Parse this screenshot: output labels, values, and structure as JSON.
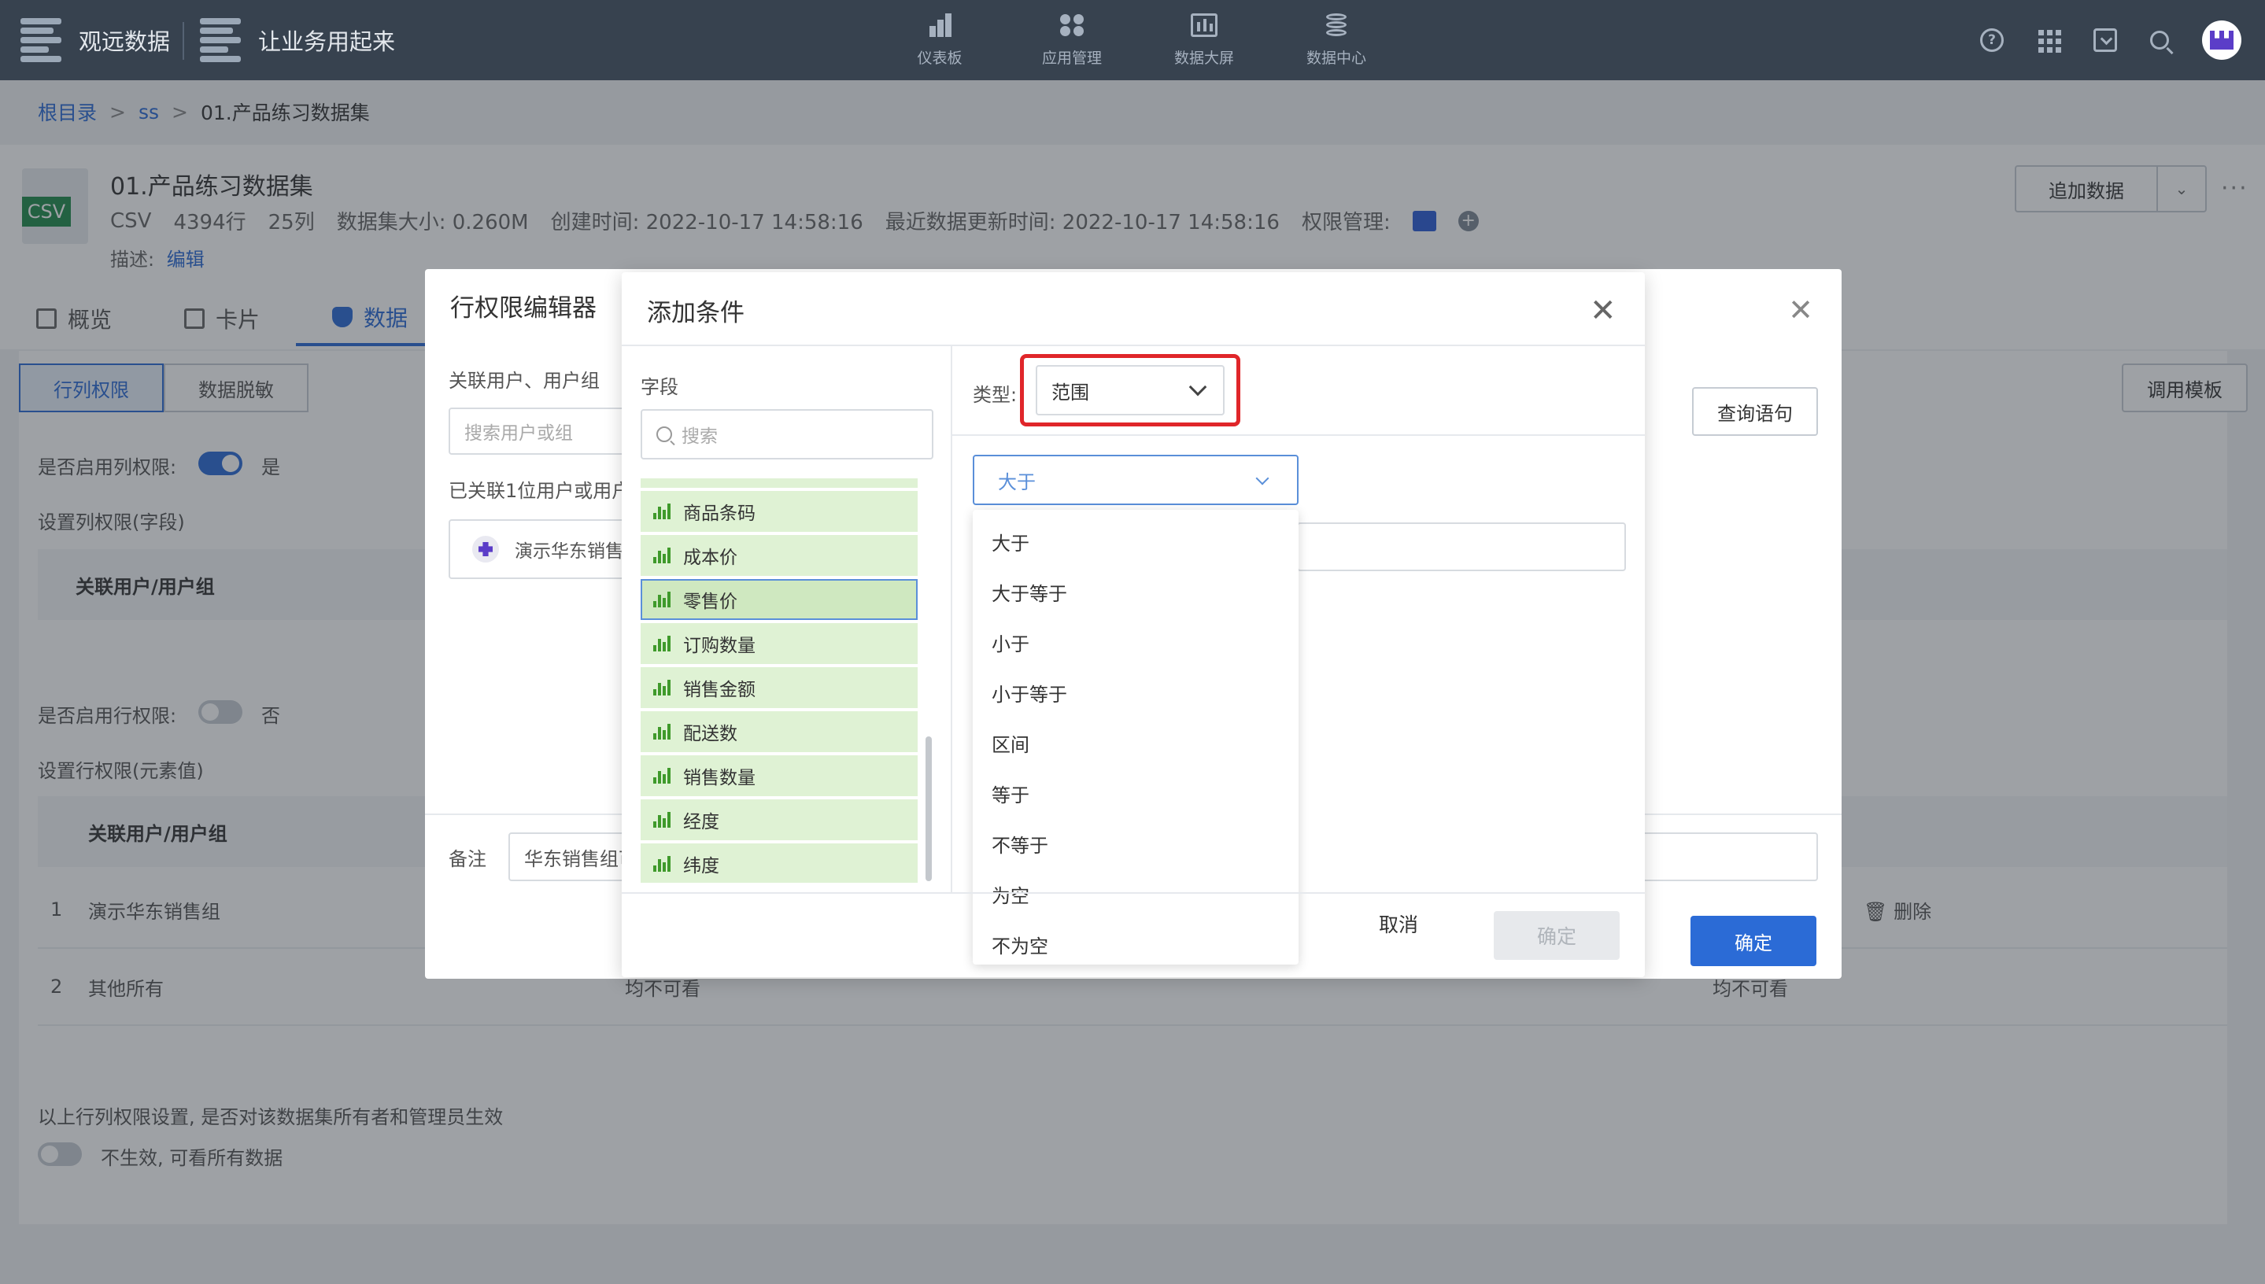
{
  "topbar": {
    "brand1": "观远数据",
    "brand2": "让业务用起来",
    "nav": [
      "仪表板",
      "应用管理",
      "数据大屏",
      "数据中心"
    ],
    "help_glyph": "?"
  },
  "breadcrumb": [
    "根目录",
    "ss",
    "01.产品练习数据集"
  ],
  "breadcrumb_sep": ">",
  "dataset": {
    "badge": "CSV",
    "title": "01.产品练习数据集",
    "type": "CSV",
    "rows": "4394行",
    "cols": "25列",
    "size": "数据集大小: 0.260M",
    "created": "创建时间: 2022-10-17 14:58:16",
    "updated": "最近数据更新时间: 2022-10-17 14:58:16",
    "perm_label": "权限管理:",
    "desc_label": "描述:",
    "edit_label": "编辑",
    "add_data": "追加数据"
  },
  "tabs": [
    "概览",
    "卡片",
    "数据"
  ],
  "page": {
    "seg": [
      "行列权限",
      "数据脱敏"
    ],
    "template_btn": "调用模板",
    "enable_col": "是否启用列权限:",
    "enable_col_val": "是",
    "set_col": "设置列权限(字段)",
    "col_th": "关联用户/用户组",
    "enable_row": "是否启用行权限:",
    "enable_row_val": "否",
    "set_row": "设置行权限(元素值)",
    "row_th": "关联用户/用户组",
    "rows": [
      {
        "idx": "1",
        "name": "演示华东销售组",
        "action": "删除"
      },
      {
        "idx": "2",
        "name": "其他所有",
        "mid": "均不可看",
        "right": "均不可看"
      }
    ],
    "owner_note": "以上行列权限设置, 是否对该数据集所有者和管理员生效",
    "owner_toggle": "不生效, 可看所有数据"
  },
  "outer_modal": {
    "title": "行权限编辑器",
    "sub": "关联用户、用户组",
    "search_placeholder": "搜索用户或组",
    "linked": "已关联1位用户或用户组",
    "chip": "演示华东销售组",
    "query_btn": "查询语句",
    "note_label": "备注",
    "note_value": "华东销售组可",
    "confirm": "确定"
  },
  "inner_modal": {
    "title": "添加条件",
    "field_label": "字段",
    "search_placeholder": "搜索",
    "fields": [
      "商品条码",
      "成本价",
      "零售价",
      "订购数量",
      "销售金额",
      "配送数",
      "销售数量",
      "经度",
      "纬度"
    ],
    "selected_field": "零售价",
    "type_label": "类型:",
    "type_value": "范围",
    "operator_value": "大于",
    "operators": [
      "大于",
      "大于等于",
      "小于",
      "小于等于",
      "区间",
      "等于",
      "不等于",
      "为空",
      "不为空"
    ],
    "cancel": "取消",
    "ok": "确定"
  },
  "colors": {
    "topbar": "#37424f",
    "accent": "#2b6bd6",
    "field_bg": "#dff2d4",
    "highlight": "#e0262a"
  }
}
